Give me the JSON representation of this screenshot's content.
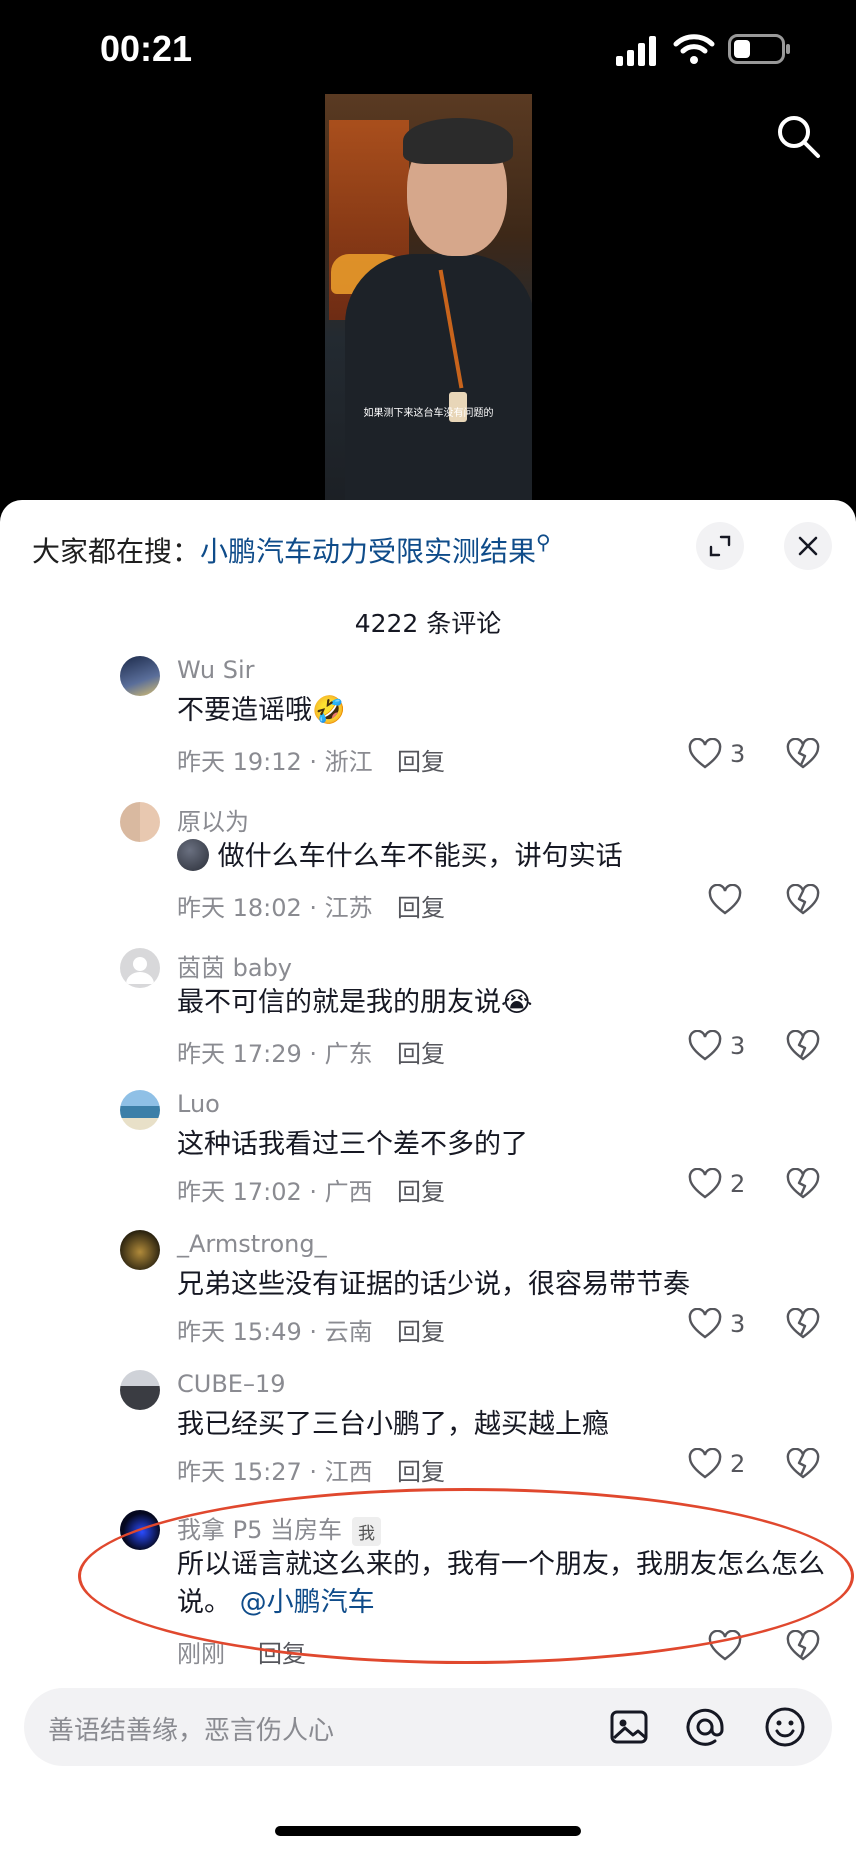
{
  "status_bar": {
    "time": "00:21"
  },
  "video": {
    "caption": "如果测下来这台车没有问题的"
  },
  "sheet": {
    "hot_search_prefix": "大家都在搜：",
    "hot_search_link": "小鹏汽车动力受限实测结果",
    "comment_count": "4222 条评论"
  },
  "comments": [
    {
      "user": "Wu Sir",
      "text": "不要造谣哦",
      "emoji": "🤣",
      "time": "昨天 19:12 · 浙江",
      "reply": "回复",
      "likes": "3"
    },
    {
      "user": "原以为",
      "text": "做什么车什么车不能买，讲句实话",
      "time": "昨天 18:02 · 江苏",
      "reply": "回复",
      "likes": ""
    },
    {
      "user": "茵茵 baby",
      "text": "最不可信的就是我的朋友说",
      "emoji": "😭",
      "time": "昨天 17:29 · 广东",
      "reply": "回复",
      "likes": "3"
    },
    {
      "user": "Luo",
      "text": "这种话我看过三个差不多的了",
      "time": "昨天 17:02 · 广西",
      "reply": "回复",
      "likes": "2"
    },
    {
      "user": "_Armstrong_",
      "text": "兄弟这些没有证据的话少说，很容易带节奏",
      "time": "昨天 15:49 · 云南",
      "reply": "回复",
      "likes": "3"
    },
    {
      "user": "CUBE–19",
      "text": "我已经买了三台小鹏了，越买越上瘾",
      "time": "昨天 15:27 · 江西",
      "reply": "回复",
      "likes": "2"
    },
    {
      "user": "我拿 P5 当房车",
      "tag": "我",
      "text": "所以谣言就这么来的，我有一个朋友，我朋友怎么怎么说。",
      "mention": "@小鹏汽车",
      "time": "刚刚",
      "reply": "回复",
      "likes": ""
    }
  ],
  "input": {
    "placeholder": "善语结善缘，恶言伤人心"
  },
  "colors": {
    "link": "#0f4c8a",
    "annotation": "#e0482e"
  }
}
